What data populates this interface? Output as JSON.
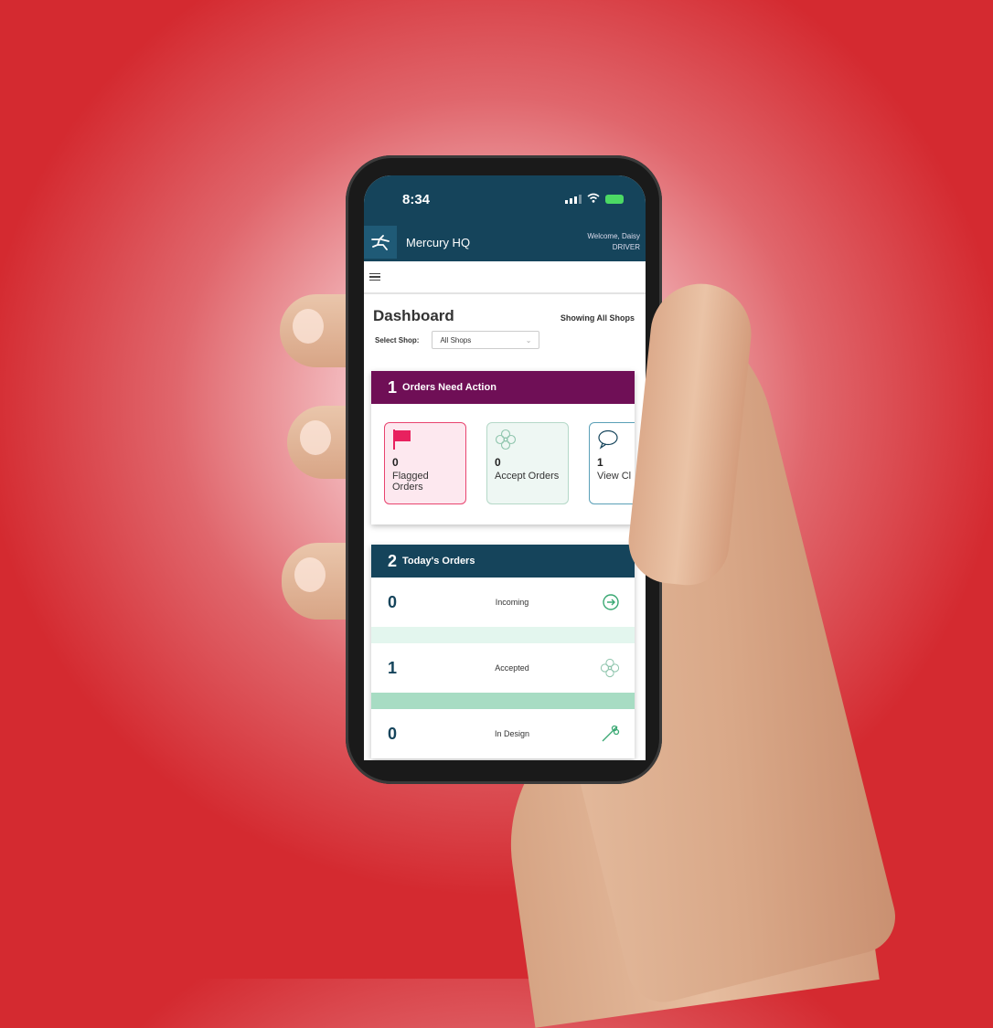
{
  "status_bar": {
    "time": "8:34"
  },
  "app": {
    "name": "Mercury HQ",
    "welcome": "Welcome, Daisy",
    "role": "DRIVER"
  },
  "dashboard": {
    "title": "Dashboard",
    "showing": "Showing All Shops",
    "select_label": "Select Shop:",
    "select_value": "All Shops"
  },
  "action_card": {
    "number": "1",
    "title": "Orders Need Action",
    "tiles": [
      {
        "count": "0",
        "label": "Flagged Orders",
        "icon": "flag-icon"
      },
      {
        "count": "0",
        "label": "Accept Orders",
        "icon": "flower-icon"
      },
      {
        "count": "1",
        "label": "View Cl",
        "icon": "chat-icon"
      }
    ]
  },
  "today_card": {
    "number": "2",
    "title": "Today's Orders",
    "rows": [
      {
        "count": "0",
        "label": "Incoming",
        "icon": "arrow-circle-icon"
      },
      {
        "count": "1",
        "label": "Accepted",
        "icon": "flower-icon"
      },
      {
        "count": "0",
        "label": "In Design",
        "icon": "shears-icon"
      }
    ]
  },
  "colors": {
    "navy": "#15445b",
    "purple": "#6f0f56",
    "flag": "#e8446f",
    "mint": "#a7dcc3",
    "accent_green": "#3aa873"
  }
}
